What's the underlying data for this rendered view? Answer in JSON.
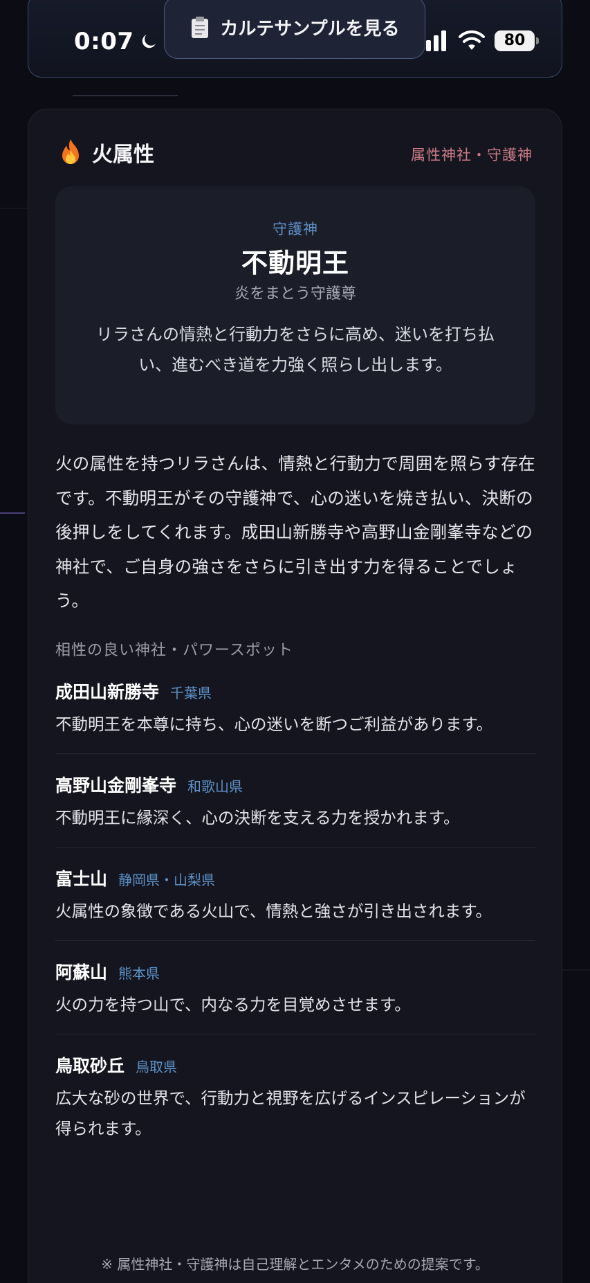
{
  "status_bar": {
    "time": "0:07",
    "battery": "80"
  },
  "top_button": {
    "label": "カルテサンプルを見る",
    "icon": "clipboard-icon"
  },
  "card": {
    "title": "火属性",
    "title_icon": "fire-icon",
    "tag": "属性神社・守護神",
    "guardian": {
      "label": "守護神",
      "name": "不動明王",
      "subtitle": "炎をまとう守護尊",
      "description": "リラさんの情熱と行動力をさらに高め、迷いを打ち払い、進むべき道を力強く照らし出します。"
    },
    "intro": "火の属性を持つリラさんは、情熱と行動力で周囲を照らす存在です。不動明王がその守護神で、心の迷いを焼き払い、決断の後押しをしてくれます。成田山新勝寺や高野山金剛峯寺などの神社で、ご自身の強さをさらに引き出す力を得ることでしょう。",
    "section_label": "相性の良い神社・パワースポット",
    "spots": [
      {
        "name": "成田山新勝寺",
        "prefecture": "千葉県",
        "description": "不動明王を本尊に持ち、心の迷いを断つご利益があります。"
      },
      {
        "name": "高野山金剛峯寺",
        "prefecture": "和歌山県",
        "description": "不動明王に縁深く、心の決断を支える力を授かれます。"
      },
      {
        "name": "富士山",
        "prefecture": "静岡県・山梨県",
        "description": "火属性の象徴である火山で、情熱と強さが引き出されます。"
      },
      {
        "name": "阿蘇山",
        "prefecture": "熊本県",
        "description": "火の力を持つ山で、内なる力を目覚めさせます。"
      },
      {
        "name": "鳥取砂丘",
        "prefecture": "鳥取県",
        "description": "広大な砂の世界で、行動力と視野を広げるインスピレーションが得られます。"
      }
    ],
    "footnote": "※ 属性神社・守護神は自己理解とエンタメのための提案です。"
  },
  "colors": {
    "accent_blue": "#5e92c9",
    "tag_pink": "#c97a85",
    "card_bg": "#14151e"
  }
}
